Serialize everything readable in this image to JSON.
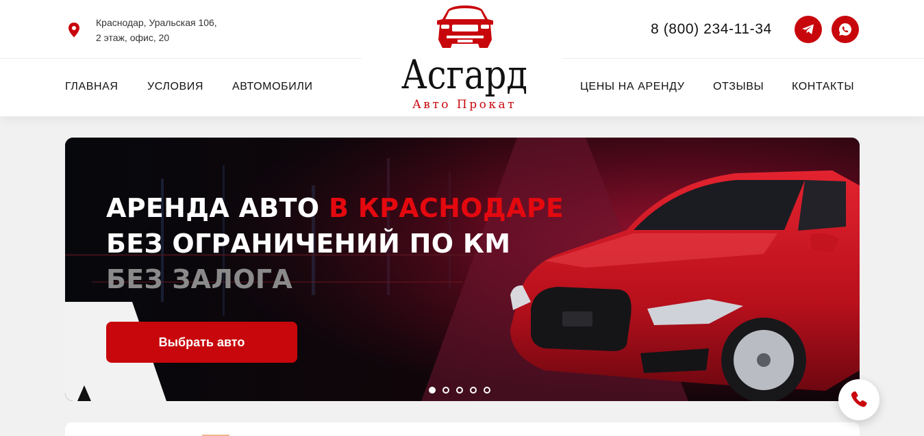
{
  "header": {
    "address_line1": "Краснодар, Уральская 106,",
    "address_line2": "2 этаж, офис, 20",
    "phone": "8 (800) 234-11-34",
    "social": [
      {
        "name": "telegram-icon"
      },
      {
        "name": "whatsapp-icon"
      }
    ]
  },
  "logo": {
    "name": "Асгард",
    "tagline": "Авто Прокат"
  },
  "nav": {
    "left": [
      "Главная",
      "Условия",
      "Автомобили"
    ],
    "right": [
      "Цены на аренду",
      "Отзывы",
      "Контакты"
    ]
  },
  "hero": {
    "line1_white": "Аренда авто ",
    "line1_red": "в Краснодаре",
    "line2": "Без ограничений по км",
    "line3": "Без залога",
    "cta_label": "Выбрать авто",
    "slides_total": 5,
    "slide_active": 1
  },
  "colors": {
    "accent": "#c8070c",
    "accent_text": "#e4090f",
    "background": "#f1f1f1",
    "muted_hero_text": "#8a8a8a"
  },
  "icons": {
    "location": "map-pin-icon",
    "call": "phone-icon"
  }
}
